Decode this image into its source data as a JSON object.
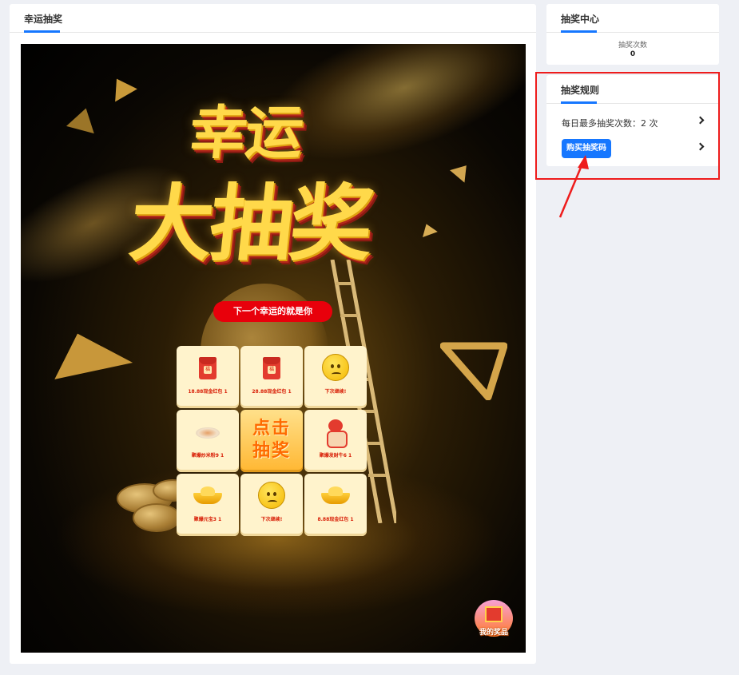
{
  "main_tab": {
    "title": "幸运抽奖"
  },
  "banner": {
    "headline_line1": "幸运",
    "headline_line2": "大抽奖",
    "slogan": "下一个幸运的就是你",
    "draw_button_line1": "点击",
    "draw_button_line2": "抽奖",
    "prizes": [
      {
        "label": "18.88现金红包 1",
        "icon": "red-packet-icon"
      },
      {
        "label": "28.88现金红包 1",
        "icon": "red-packet-icon"
      },
      {
        "label": "下次继续!",
        "icon": "sad-face-icon"
      },
      {
        "label": "聚爆炒米粉9 1",
        "icon": "noodle-dish-icon"
      },
      {
        "label": "聚爆发财牛6 1",
        "icon": "fortune-ox-icon"
      },
      {
        "label": "聚爆元宝3 1",
        "icon": "gold-ingot-icon"
      },
      {
        "label": "下次继续!",
        "icon": "sad-face-icon"
      },
      {
        "label": "8.88现金红包 1",
        "icon": "gold-ingot-icon"
      }
    ],
    "red_packet_char": "福",
    "my_prizes_label": "我的奖品"
  },
  "center": {
    "title": "抽奖中心",
    "count_label": "抽奖次数",
    "count_value": "0"
  },
  "rules": {
    "title": "抽奖规则",
    "daily_limit_text": "每日最多抽奖次数：2 次",
    "buy_code_label": "购买抽奖码"
  },
  "colors": {
    "accent": "#1677ff",
    "annotation_red": "#ee1c1c",
    "slogan_red": "#e8000b"
  }
}
